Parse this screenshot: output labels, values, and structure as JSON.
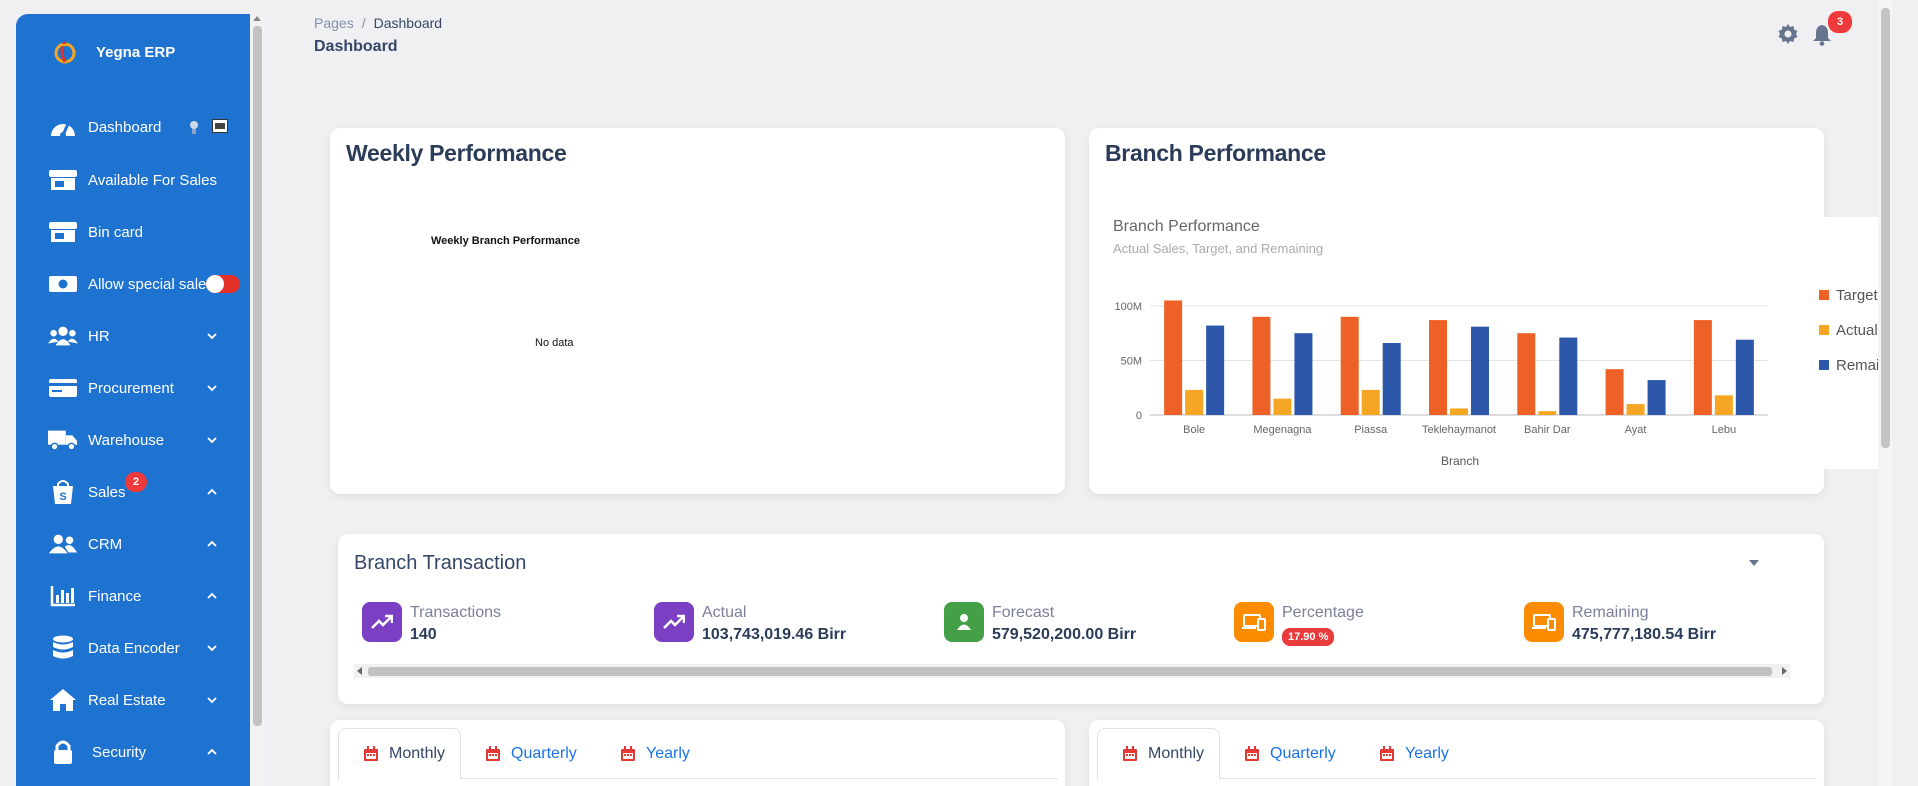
{
  "app": {
    "name": "Yegna ERP"
  },
  "sidebar": {
    "items": [
      {
        "label": "Dashboard",
        "icon": "speedometer-icon"
      },
      {
        "label": "Available For Sales",
        "icon": "store-icon"
      },
      {
        "label": "Bin card",
        "icon": "store-icon"
      },
      {
        "label": "Allow special sales",
        "icon": "money-icon",
        "toggle": true
      },
      {
        "label": "HR",
        "icon": "users-icon",
        "chevron": "down"
      },
      {
        "label": "Procurement",
        "icon": "credit-card-icon",
        "chevron": "down"
      },
      {
        "label": "Warehouse",
        "icon": "truck-icon",
        "chevron": "down"
      },
      {
        "label": "Sales",
        "icon": "shopping-bag-icon",
        "chevron": "up",
        "badge": "2"
      },
      {
        "label": "CRM",
        "icon": "user-group-icon",
        "chevron": "up"
      },
      {
        "label": "Finance",
        "icon": "bar-chart-icon",
        "chevron": "up"
      },
      {
        "label": "Data Encoder",
        "icon": "database-icon",
        "chevron": "down"
      },
      {
        "label": "Real Estate",
        "icon": "home-icon",
        "chevron": "down"
      },
      {
        "label": "Security",
        "icon": "lock-icon",
        "chevron": "up"
      }
    ]
  },
  "header": {
    "breadcrumb": {
      "root": "Pages",
      "separator": "/",
      "current": "Dashboard"
    },
    "title": "Dashboard",
    "notifications_count": "3"
  },
  "weekly": {
    "title": "Weekly Performance",
    "chart_title": "Weekly Branch Performance",
    "no_data": "No data"
  },
  "branch": {
    "title": "Branch Performance"
  },
  "chart_data": {
    "type": "bar",
    "title": "Branch Performance",
    "subtitle": "Actual Sales, Target, and Remaining",
    "xlabel": "Branch",
    "ylabel": "",
    "categories": [
      "Bole",
      "Megenagna",
      "Piassa",
      "Teklehaymanot",
      "Bahir Dar",
      "Ayat",
      "Lebu"
    ],
    "yticks": [
      "0",
      "50M",
      "100M"
    ],
    "ylim": [
      0,
      110000000
    ],
    "legend_position": "right",
    "series": [
      {
        "name": "Target",
        "color": "#ee6126",
        "values": [
          105000000,
          90000000,
          90000000,
          87000000,
          75000000,
          42000000,
          87000000
        ]
      },
      {
        "name": "Actual",
        "color": "#f5a623",
        "values": [
          23000000,
          15000000,
          23000000,
          6000000,
          3500000,
          10000000,
          18000000
        ]
      },
      {
        "name": "Remaining",
        "color": "#2d57a8",
        "values": [
          82000000,
          75000000,
          66000000,
          81000000,
          71000000,
          32000000,
          69000000
        ]
      }
    ],
    "legend_labels": [
      "Target",
      "Actual",
      "Remain"
    ]
  },
  "transaction": {
    "title": "Branch Transaction",
    "stats": [
      {
        "label": "Transactions",
        "value": "140",
        "color": "#7b3fc4",
        "icon": "trend-up-icon"
      },
      {
        "label": "Actual",
        "value": "103,743,019.46 Birr",
        "color": "#7b3fc4",
        "icon": "trend-up-icon"
      },
      {
        "label": "Forecast",
        "value": "579,520,200.00 Birr",
        "color": "#43a047",
        "icon": "person-icon"
      },
      {
        "label": "Percentage",
        "value": "17.90 %",
        "color": "#fb8c00",
        "icon": "devices-icon"
      },
      {
        "label": "Remaining",
        "value": "475,777,180.54 Birr",
        "color": "#fb8c00",
        "icon": "devices-icon"
      }
    ]
  },
  "tabs": {
    "left": [
      "Monthly",
      "Quarterly",
      "Yearly"
    ],
    "right": [
      "Monthly",
      "Quarterly",
      "Yearly"
    ]
  }
}
